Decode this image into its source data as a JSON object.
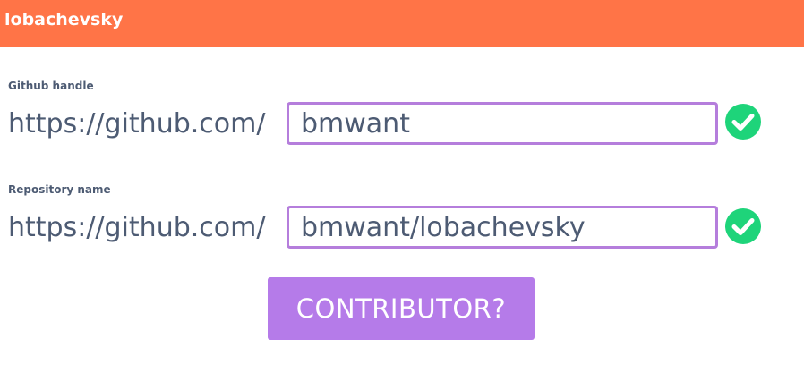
{
  "app": {
    "title": "lobachevsky",
    "header_color": "#ff7447"
  },
  "form": {
    "github_handle": {
      "label": "Github handle",
      "prefix": "https://github.com/",
      "value": "bmwant",
      "valid": true,
      "icon": "check-circle-icon"
    },
    "repository_name": {
      "label": "Repository name",
      "prefix": "https://github.com/",
      "value": "bmwant/lobachevsky",
      "valid": true,
      "icon": "check-circle-icon"
    },
    "submit_label": "CONTRIBUTOR?"
  },
  "colors": {
    "accent": "#b57be9",
    "valid": "#1ed47a",
    "text": "#4d5b73"
  }
}
